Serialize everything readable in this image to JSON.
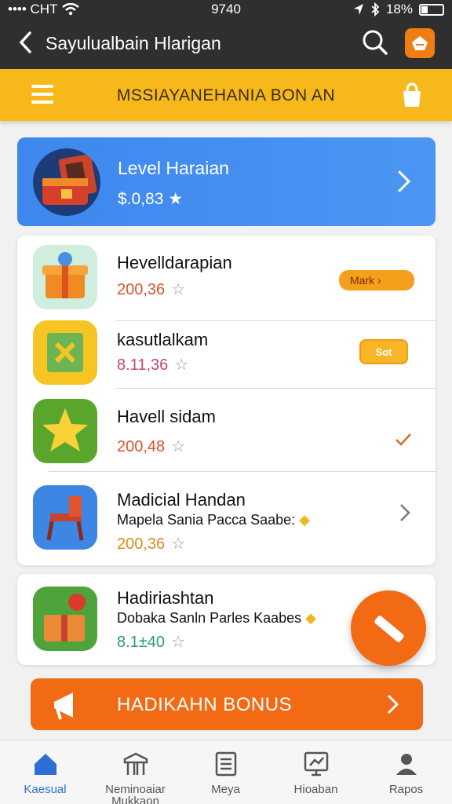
{
  "status_bar": {
    "carrier": "•••• CHT",
    "time": "9740",
    "battery": "18%"
  },
  "nav": {
    "title": "Sayulualbain Hlarigan"
  },
  "banner": {
    "title": "MSSIAYANEHANIA BON AN"
  },
  "level_card": {
    "title": "Level Haraian",
    "value": "$.0,83 ★"
  },
  "rows": [
    {
      "title": "Hevelldarapian",
      "value": "200,36",
      "badge": "Mark ›",
      "value_color": "#d9532a"
    },
    {
      "title": "kasutlalkam",
      "value": "8.11,36",
      "chip": "Sot",
      "value_color": "#c4477a"
    },
    {
      "title": "Havell sidam",
      "value": "200,48",
      "value_color": "#d9532a"
    },
    {
      "title": "Madicial Handan",
      "subtitle": "Mapela Sania Pacca Saabe:",
      "value": "200,36",
      "value_color": "#e08a1c"
    }
  ],
  "card2": {
    "title": "Hadiriashtan",
    "subtitle": "Dobaka Sanln Parles Kaabes",
    "value": "8.1±40",
    "value_color": "#2a9a7a"
  },
  "bonus": {
    "label": "HADIKAHN BONUS"
  },
  "tabs": [
    {
      "label": "Kaesual"
    },
    {
      "label": "Neminoaiar Mukkaon"
    },
    {
      "label": "Meya"
    },
    {
      "label": "Hioaban"
    },
    {
      "label": "Rapos"
    }
  ],
  "colors": {
    "accent_orange": "#f26b14",
    "banner_yellow": "#f7b81b",
    "card_blue": "#4b95f3",
    "tab_active": "#2f6fd4"
  }
}
